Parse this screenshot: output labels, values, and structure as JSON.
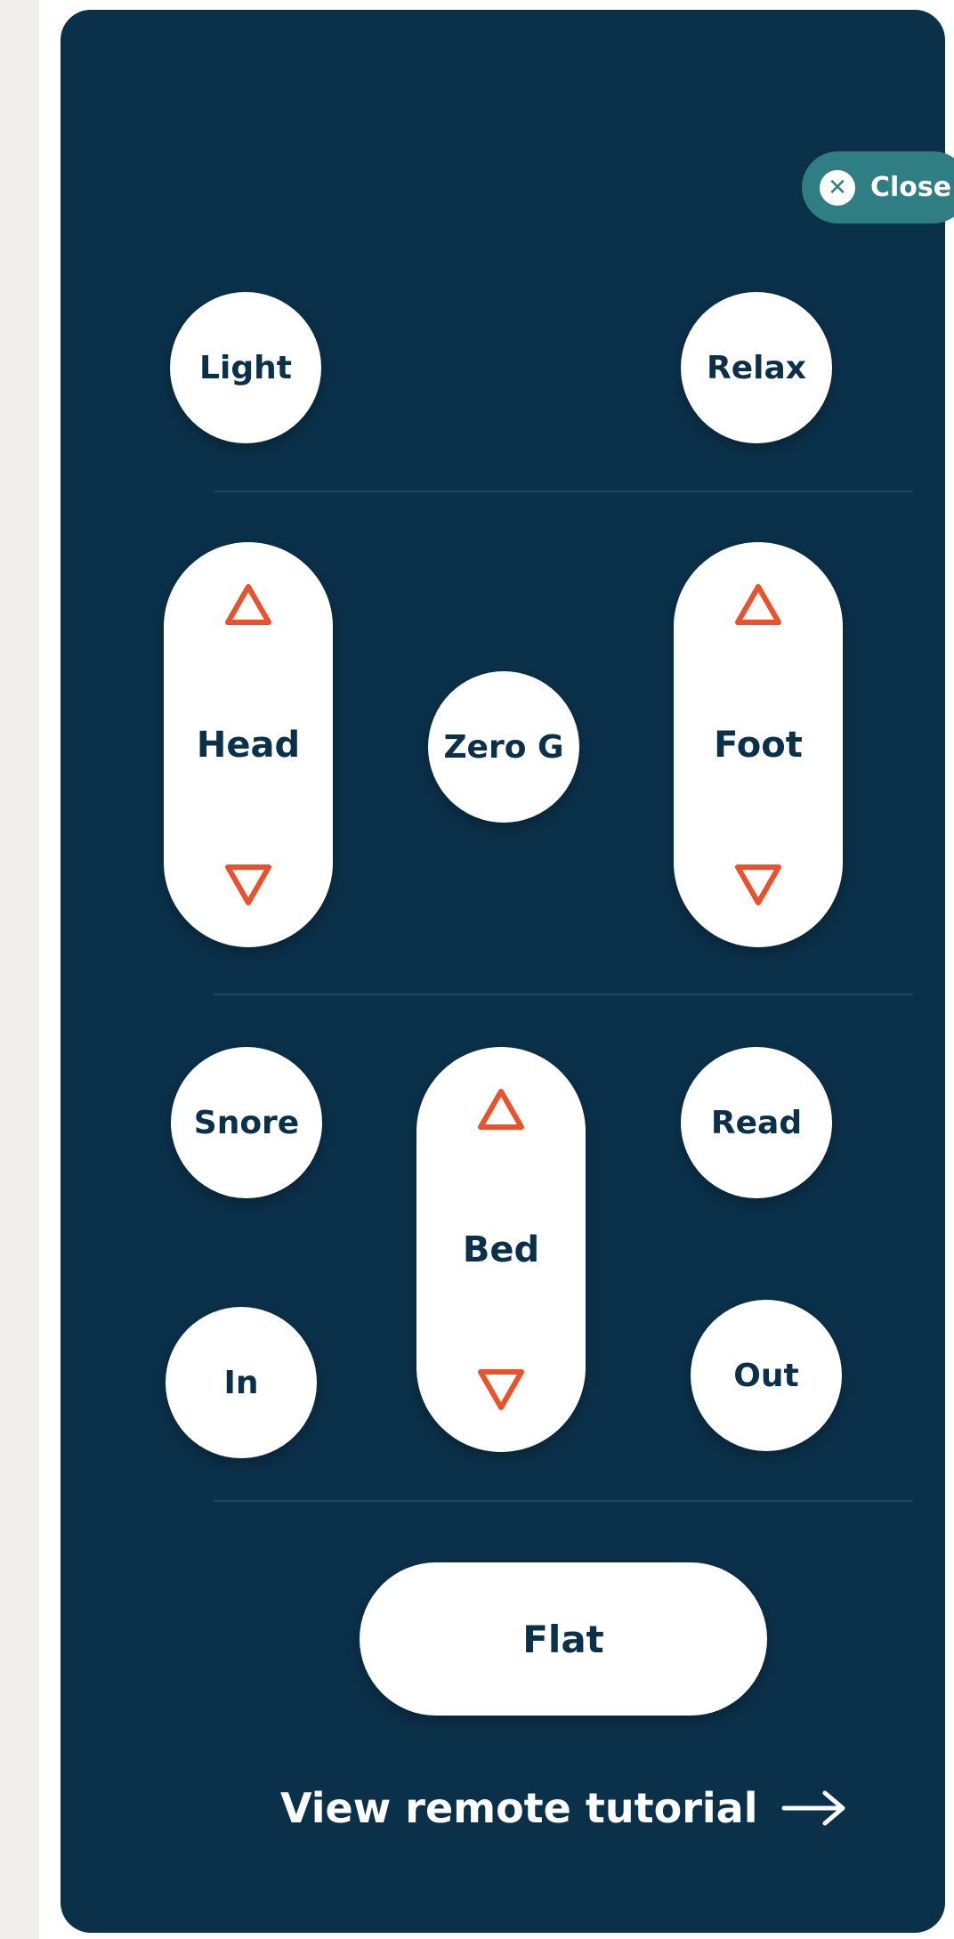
{
  "remote": {
    "close_label": "Close",
    "close_icon": "x-circle-icon",
    "top_buttons": {
      "light": "Light",
      "relax": "Relax"
    },
    "head": {
      "label": "Head"
    },
    "zero_g": "Zero G",
    "foot": {
      "label": "Foot"
    },
    "snore": "Snore",
    "read": "Read",
    "bed": {
      "label": "Bed"
    },
    "in": "In",
    "out": "Out",
    "flat": "Flat",
    "tutorial_link": "View remote tutorial",
    "tutorial_icon": "arrow-right-icon"
  },
  "colors": {
    "panel_background": "#0b3049",
    "close_button": "#2f7e83",
    "arrow_accent": "#e8522c",
    "button_text": "#0b3049",
    "button_background": "#ffffff"
  }
}
